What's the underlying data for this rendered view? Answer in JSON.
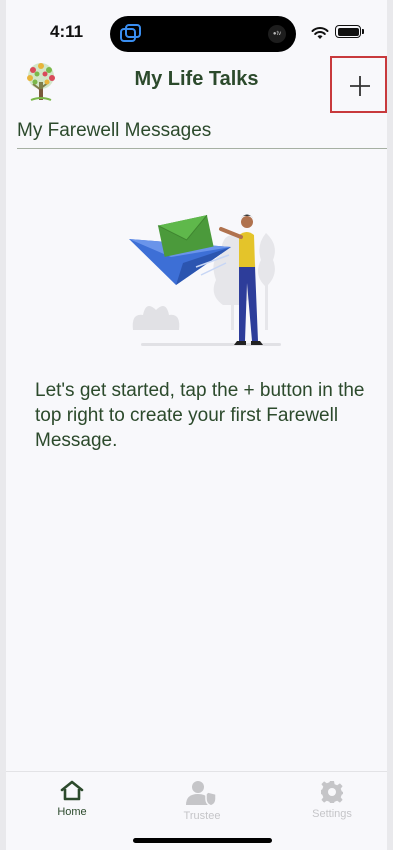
{
  "status_bar": {
    "time": "4:11",
    "island_badge": "●tv",
    "battery_level": 1.0
  },
  "header": {
    "title": "My Life Talks",
    "logo_icon": "tree-of-hearts-logo",
    "add_icon": "plus-icon"
  },
  "main": {
    "section_title": "My Farewell Messages",
    "empty_state_message": "Let's get started, tap the + button in the top right to create your first Farewell Message.",
    "illustration": "person-sending-envelope-paper-plane"
  },
  "tab_bar": {
    "tabs": [
      {
        "label": "Home",
        "icon": "home-icon",
        "active": true
      },
      {
        "label": "Trustee",
        "icon": "trustee-icon",
        "active": false
      },
      {
        "label": "Settings",
        "icon": "gear-icon",
        "active": false
      }
    ]
  },
  "colors": {
    "primary_text": "#2c4a2c",
    "highlight_border": "#c8393c",
    "inactive_tab": "#c5c5c8",
    "background": "#f8f8fb"
  }
}
